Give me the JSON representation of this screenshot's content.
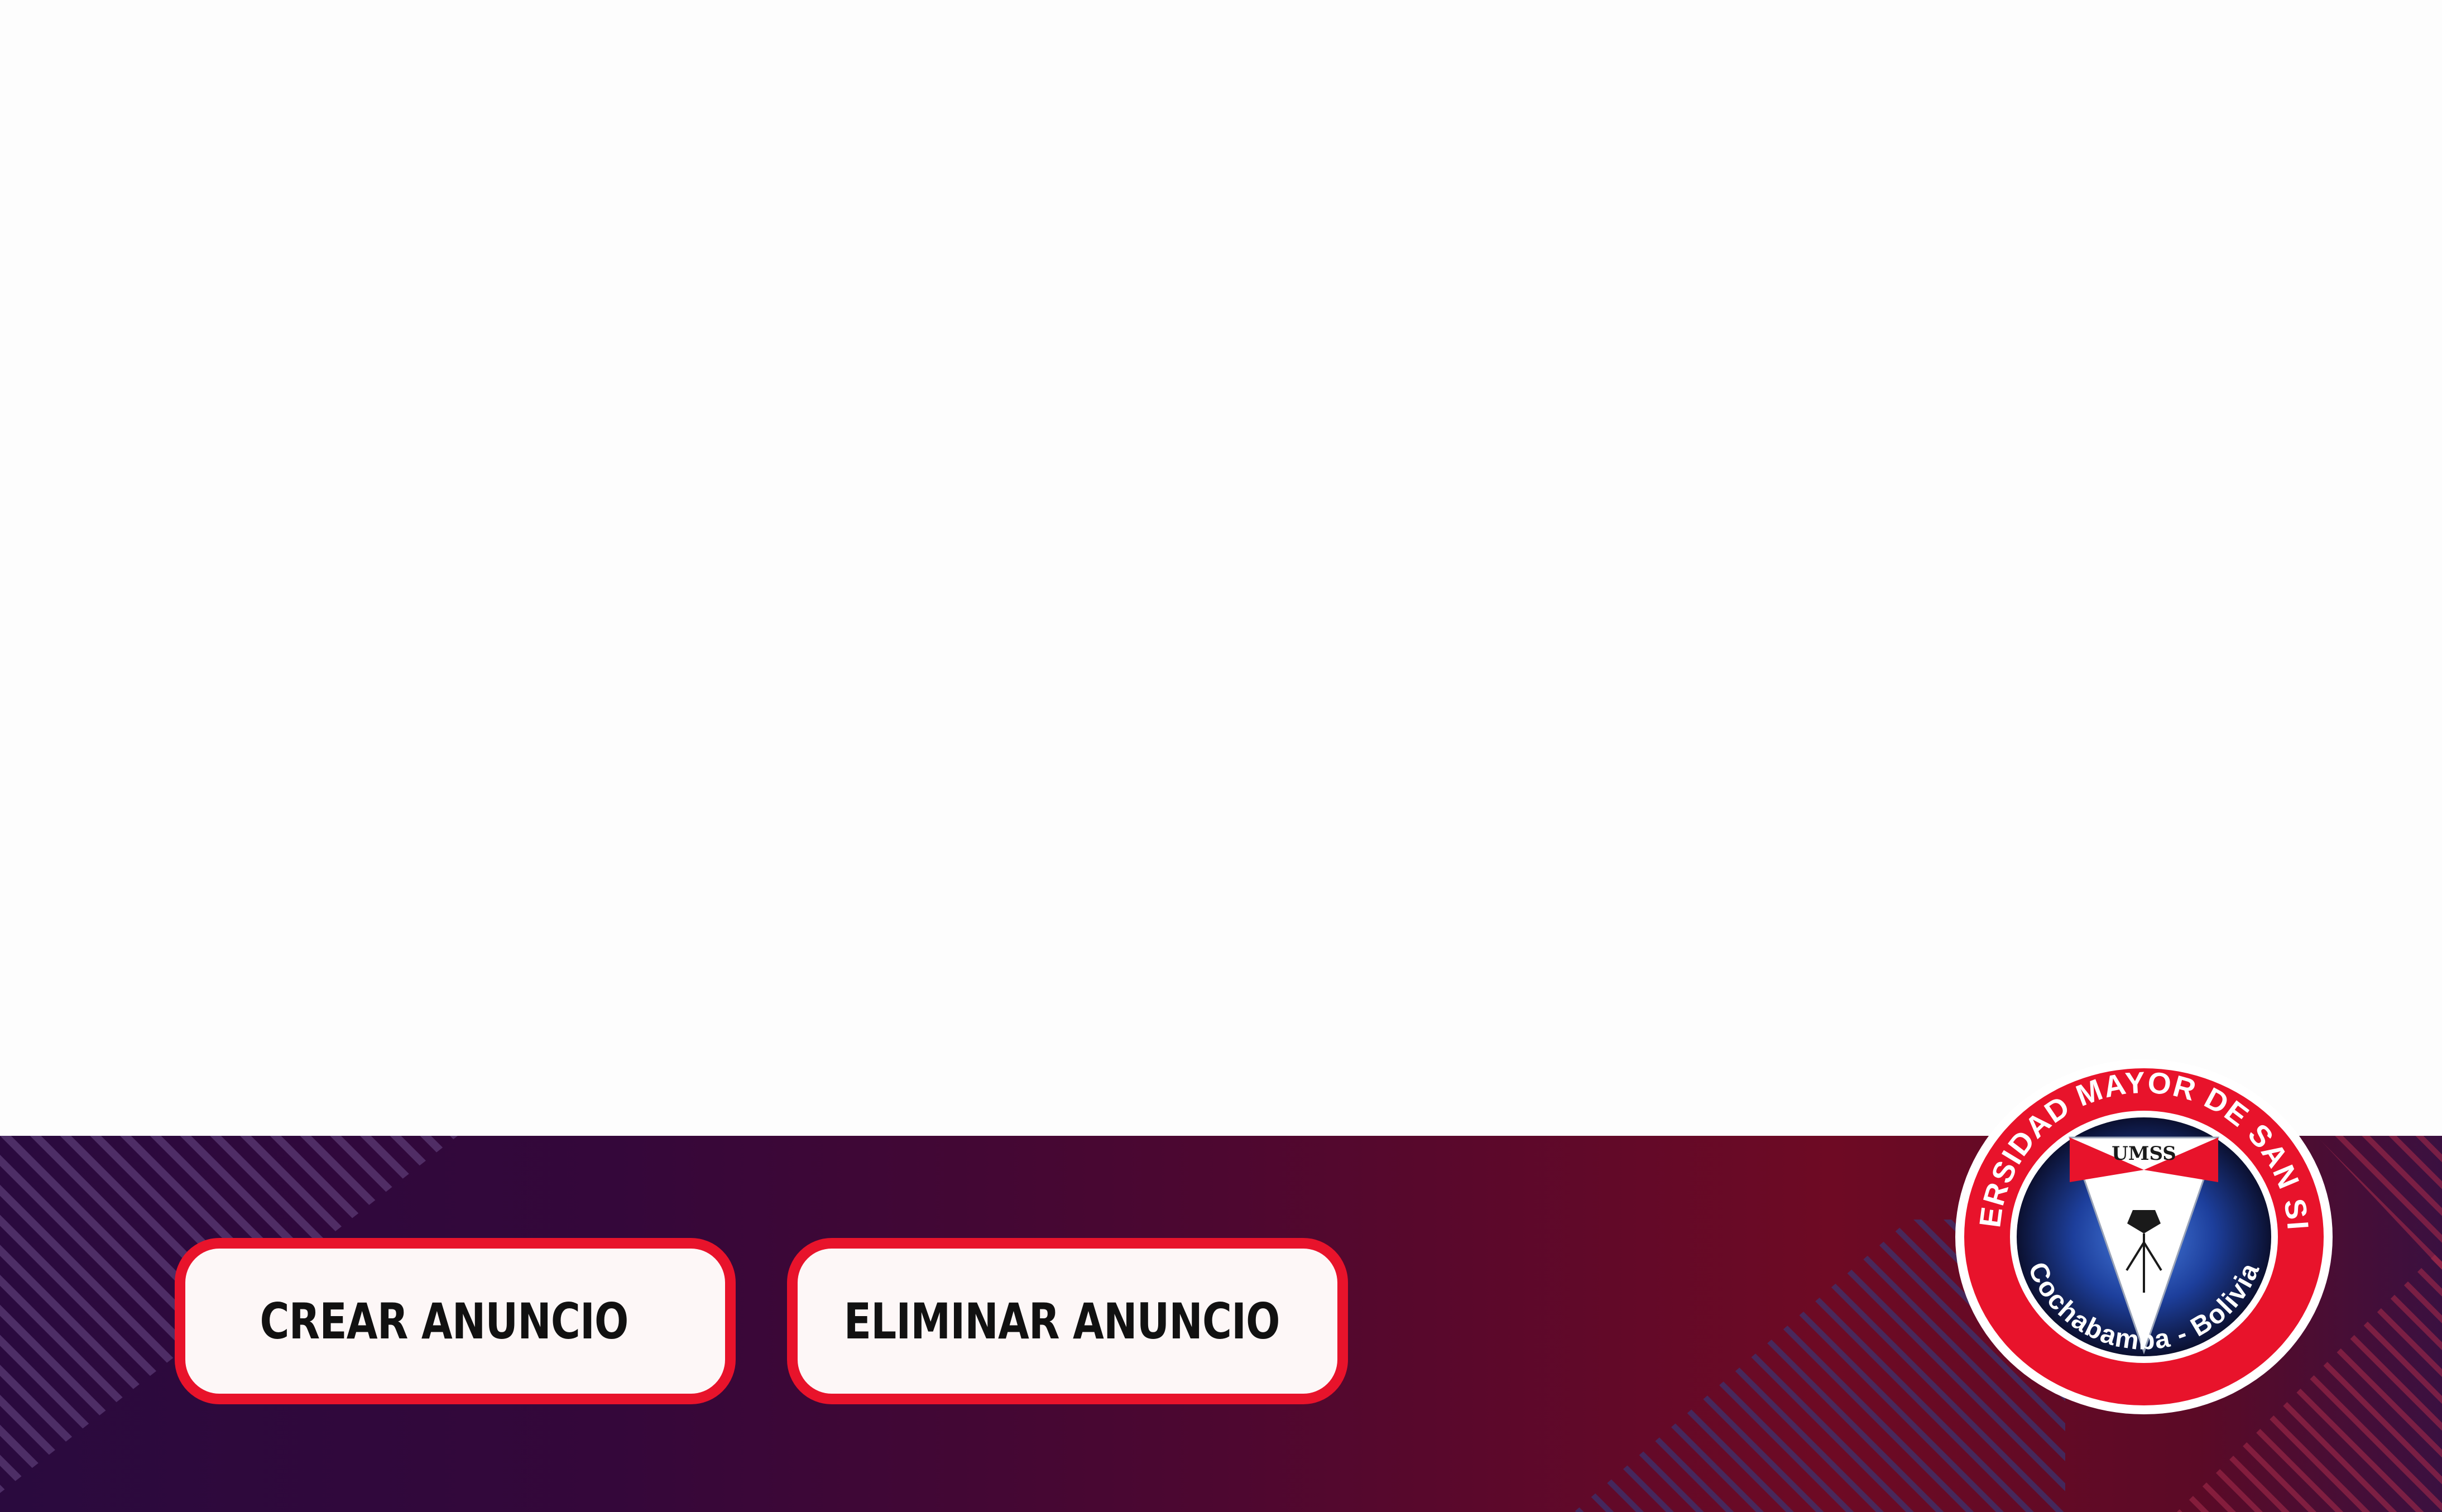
{
  "actions": {
    "create_label": "CREAR ANUNCIO",
    "delete_label": "ELIMINAR ANUNCIO"
  },
  "logo": {
    "ring_top_text": "UNIVERSIDAD MAYOR DE SAN SIMON",
    "ring_bottom_text": "Cochabamba - Bolivia",
    "shield_text": "UMSS"
  },
  "colors": {
    "accent_red": "#e8132b",
    "footer_start": "#2a0a3e",
    "footer_end": "#6e0a24",
    "button_bg": "#fdf7f7",
    "seal_blue": "#1d3f9c"
  }
}
